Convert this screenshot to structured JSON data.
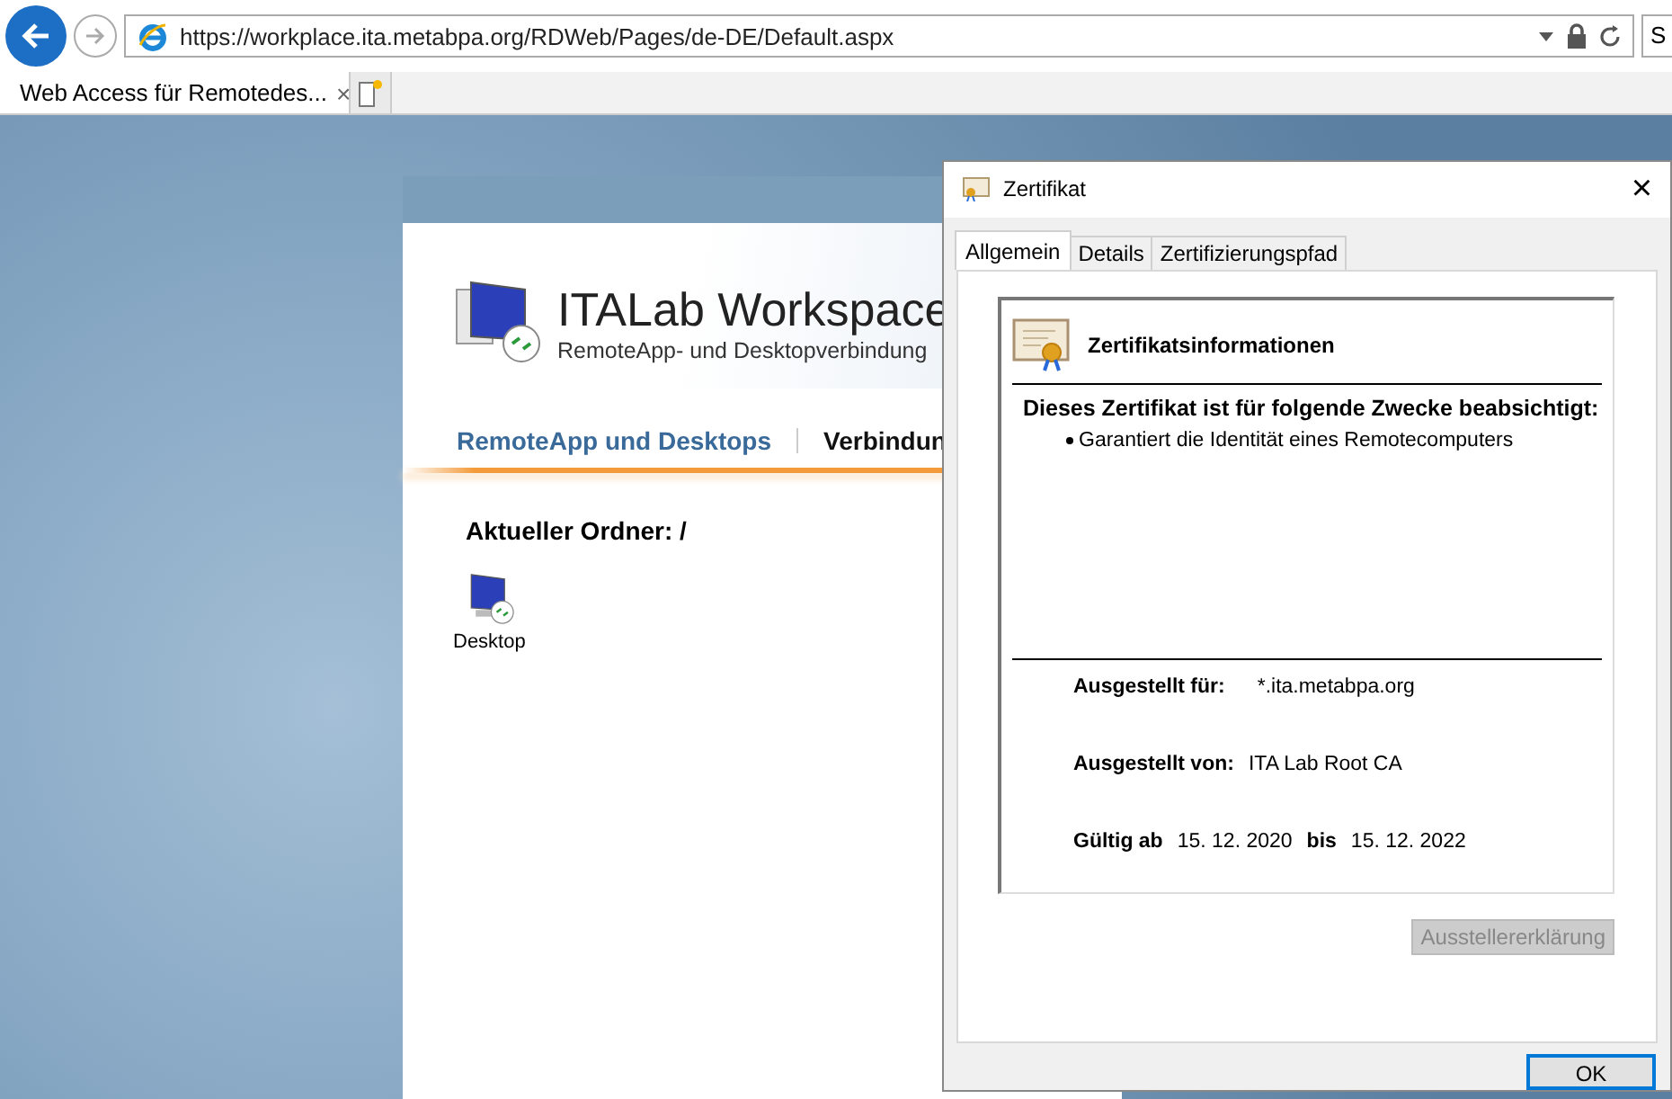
{
  "browser": {
    "back_enabled": true,
    "forward_enabled": false,
    "url": "https://workplace.ita.metabpa.org/RDWeb/Pages/de-DE/Default.aspx",
    "search_partial": "S",
    "tabs": [
      {
        "label": "Web Access für Remotedes...",
        "close": "×",
        "selected": true
      }
    ]
  },
  "page": {
    "title": "ITALab Workspace",
    "subtitle": "RemoteApp- und Desktopverbindung",
    "nav": [
      {
        "label": "RemoteApp und Desktops",
        "selected": true
      },
      {
        "label": "Verbindun",
        "selected": false
      }
    ],
    "folder_label": "Aktueller Ordner: /",
    "items": [
      {
        "label": "Desktop"
      }
    ]
  },
  "dialog": {
    "title": "Zertifikat",
    "close": "×",
    "tabs": [
      {
        "label": "Allgemein",
        "selected": true
      },
      {
        "label": "Details",
        "selected": false
      },
      {
        "label": "Zertifizierungspfad",
        "selected": false
      }
    ],
    "heading": "Zertifikatsinformationen",
    "purpose_heading": "Dieses Zertifikat ist für folgende Zwecke beabsichtigt:",
    "purposes": [
      "Garantiert die Identität eines Remotecomputers"
    ],
    "issued_to_label": "Ausgestellt für:",
    "issued_to": "*.ita.metabpa.org",
    "issued_by_label": "Ausgestellt von:",
    "issued_by": "ITA Lab Root CA",
    "valid_from_label": "Gültig ab",
    "valid_from": "15. 12. 2020",
    "valid_to_label": "bis",
    "valid_to": "15. 12. 2022",
    "statement_button": {
      "label": "Ausstellererklärung",
      "disabled": true
    },
    "ok_button": {
      "label": "OK",
      "focused": true
    }
  }
}
